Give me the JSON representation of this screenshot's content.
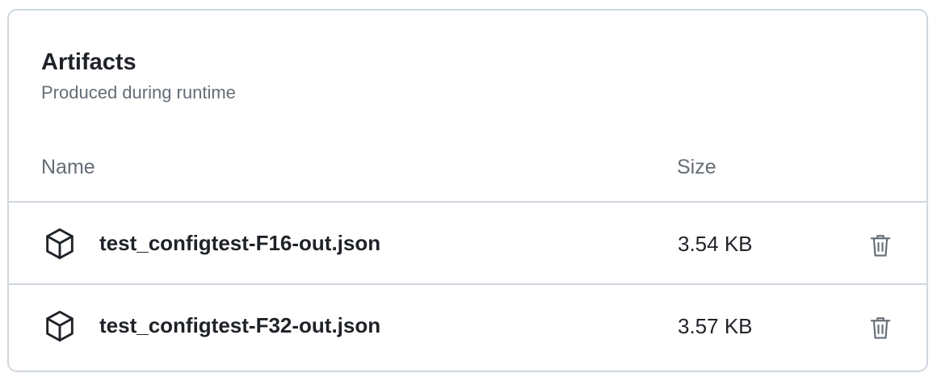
{
  "artifacts": {
    "title": "Artifacts",
    "subtitle": "Produced during runtime",
    "columns": {
      "name": "Name",
      "size": "Size"
    },
    "items": [
      {
        "name": "test_configtest-F16-out.json",
        "size": "3.54 KB",
        "icon": "package-icon"
      },
      {
        "name": "test_configtest-F32-out.json",
        "size": "3.57 KB",
        "icon": "package-icon"
      }
    ]
  },
  "colors": {
    "border": "#d0d7de",
    "text_primary": "#1f2328",
    "text_muted": "#656d76",
    "icon": "#1f2328",
    "delete_icon": "#656d76"
  }
}
